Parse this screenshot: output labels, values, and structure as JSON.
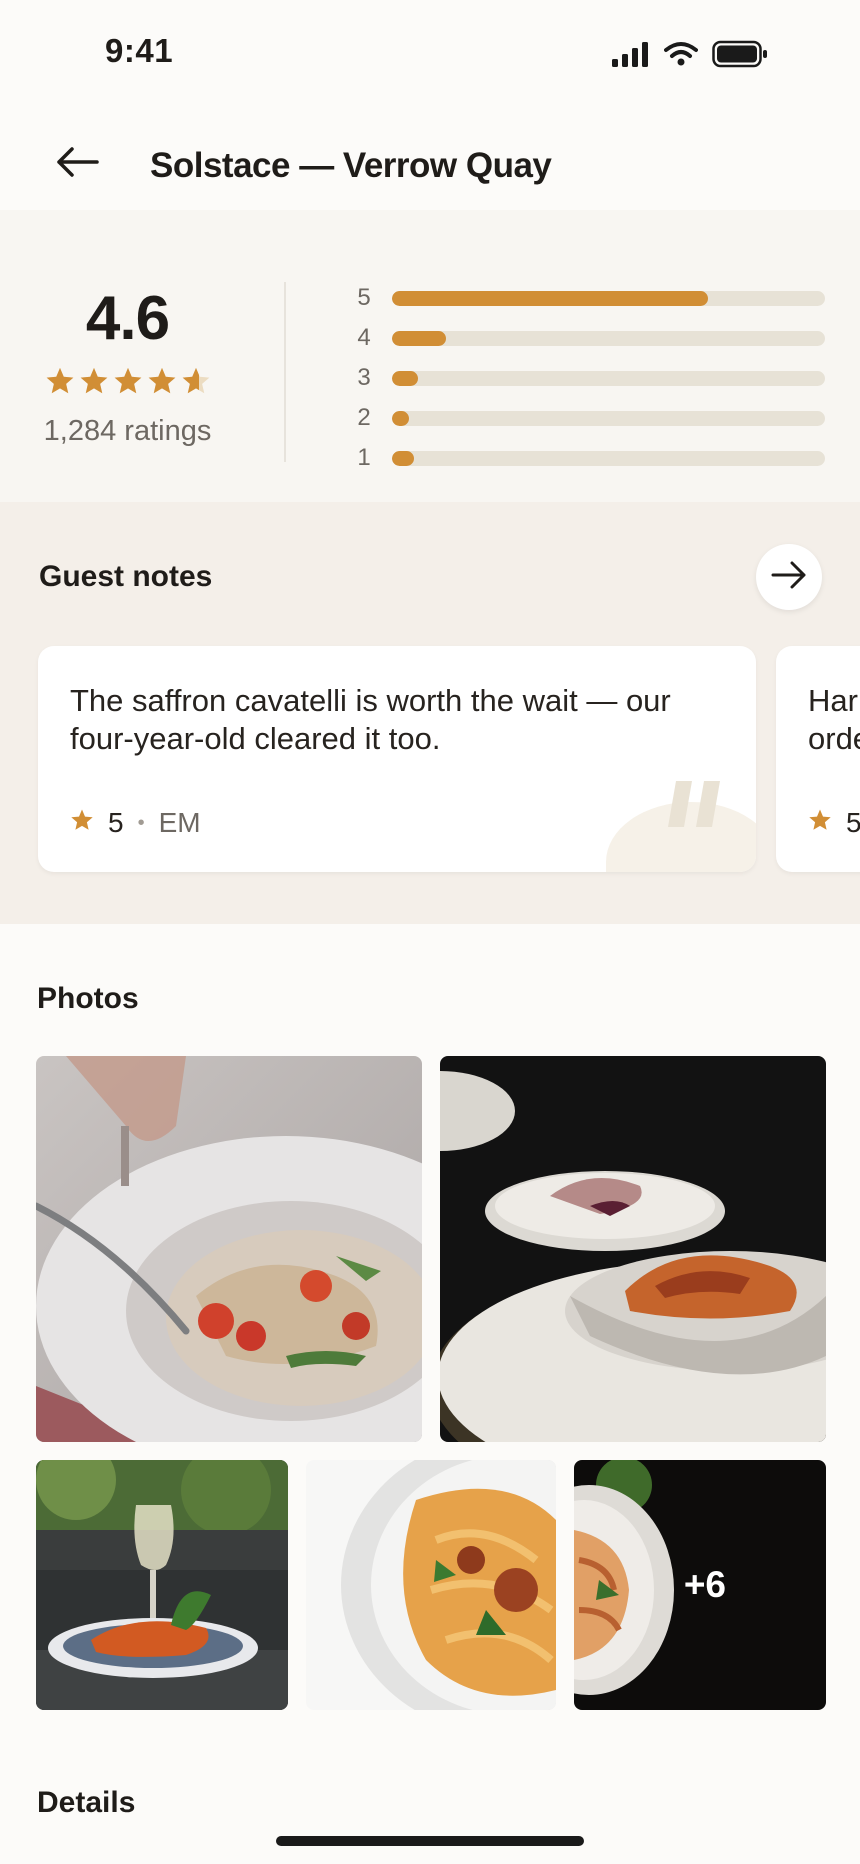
{
  "status_bar": {
    "time": "9:41",
    "icons": [
      "signal-icon",
      "wifi-icon",
      "battery-icon"
    ]
  },
  "header": {
    "back_icon": "arrow-left-icon",
    "title": "Solstace — Verrow Quay"
  },
  "ratings": {
    "average": "4.6",
    "stars_filled": 4.6,
    "count_label": "1,284 ratings",
    "distribution": [
      {
        "label": "5",
        "fraction": 0.73
      },
      {
        "label": "4",
        "fraction": 0.125
      },
      {
        "label": "3",
        "fraction": 0.06
      },
      {
        "label": "2",
        "fraction": 0.035
      },
      {
        "label": "1",
        "fraction": 0.05
      }
    ]
  },
  "guest_notes": {
    "title": "Guest notes",
    "arrow_icon": "arrow-right-icon",
    "cards": [
      {
        "text": "The saffron cavatelli is worth the wait — our four-year-old cleared it too.",
        "rating": "5",
        "author": "EM"
      },
      {
        "text": "Har… orde…",
        "rating": "5",
        "author": ""
      }
    ]
  },
  "photos": {
    "title": "Photos",
    "more_label": "+6"
  },
  "details": {
    "title": "Details"
  },
  "colors": {
    "accent": "#d18e35",
    "track": "#e7e2d6",
    "notes_bg": "#f4efe9"
  }
}
